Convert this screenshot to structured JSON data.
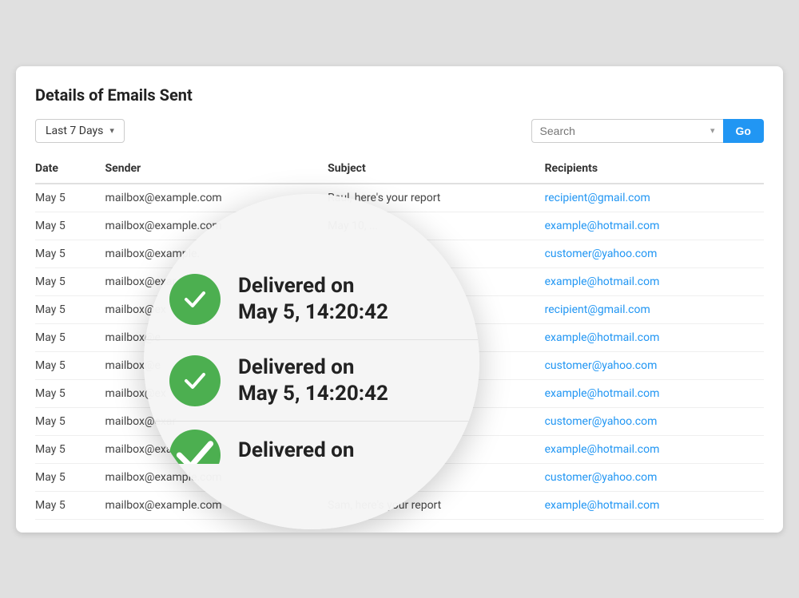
{
  "card": {
    "title": "Details of Emails Sent"
  },
  "toolbar": {
    "filter_label": "Last 7 Days",
    "filter_chevron": "▾",
    "search_placeholder": "Search",
    "search_chevron": "▾",
    "go_button": "Go"
  },
  "table": {
    "headers": [
      "Date",
      "Sender",
      "Subject",
      "Recipients"
    ],
    "rows": [
      {
        "date": "May 5",
        "sender": "mailbox@example.com",
        "subject": "Raul, here's your report",
        "recipient": "recipient@gmail.com"
      },
      {
        "date": "May 5",
        "sender": "mailbox@example.com",
        "subject": "May 10, ...",
        "recipient": "example@hotmail.com"
      },
      {
        "date": "May 5",
        "sender": "mailbox@example.",
        "subject": "",
        "recipient": "customer@yahoo.com"
      },
      {
        "date": "May 5",
        "sender": "mailbox@exar",
        "subject": "",
        "recipient": "example@hotmail.com"
      },
      {
        "date": "May 5",
        "sender": "mailbox@ex",
        "subject": "",
        "recipient": "recipient@gmail.com"
      },
      {
        "date": "May 5",
        "sender": "mailbox@e",
        "subject": "",
        "recipient": "example@hotmail.com"
      },
      {
        "date": "May 5",
        "sender": "mailbox@e",
        "subject": "",
        "recipient": "customer@yahoo.com"
      },
      {
        "date": "May 5",
        "sender": "mailbox@ex",
        "subject": "",
        "recipient": "example@hotmail.com"
      },
      {
        "date": "May 5",
        "sender": "mailbox@exar",
        "subject": "",
        "recipient": "customer@yahoo.com"
      },
      {
        "date": "May 5",
        "sender": "mailbox@example.",
        "subject": "",
        "recipient": "example@hotmail.com"
      },
      {
        "date": "May 5",
        "sender": "mailbox@example.com",
        "subject": "",
        "recipient": "customer@yahoo.com"
      },
      {
        "date": "May 5",
        "sender": "mailbox@example.com",
        "subject": "Sam, here's your report",
        "recipient": "example@hotmail.com"
      }
    ]
  },
  "magnifier": {
    "items": [
      {
        "check_icon": "✓",
        "line1": "Delivered on",
        "line2": "May 5, 14:20:42"
      },
      {
        "check_icon": "✓",
        "line1": "Delivered on",
        "line2": "May 5, 14:20:42"
      },
      {
        "check_icon": "✓",
        "line1": "Delivered on",
        "line2": ""
      }
    ]
  },
  "colors": {
    "accent_blue": "#2196F3",
    "green": "#4CAF50",
    "link_blue": "#2196F3"
  }
}
